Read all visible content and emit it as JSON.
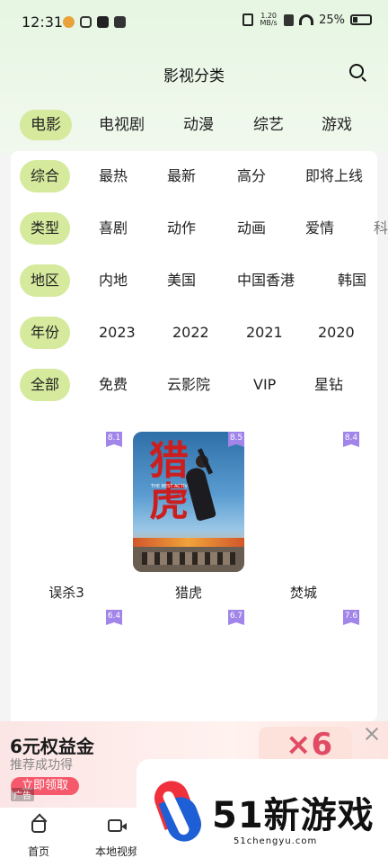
{
  "status_bar": {
    "time": "12:31",
    "net_speed_value": "1.20",
    "net_speed_unit": "MB/s",
    "battery": "25%"
  },
  "header": {
    "title": "影视分类"
  },
  "category_tabs": [
    {
      "label": "电影",
      "active": true
    },
    {
      "label": "电视剧",
      "active": false
    },
    {
      "label": "动漫",
      "active": false
    },
    {
      "label": "综艺",
      "active": false
    },
    {
      "label": "游戏",
      "active": false
    }
  ],
  "filters": [
    {
      "chip": "综合",
      "options": [
        "最热",
        "最新",
        "高分",
        "即将上线"
      ]
    },
    {
      "chip": "类型",
      "options": [
        "喜剧",
        "动作",
        "动画",
        "爱情",
        "科"
      ]
    },
    {
      "chip": "地区",
      "options": [
        "内地",
        "美国",
        "中国香港",
        "韩国"
      ]
    },
    {
      "chip": "年份",
      "options": [
        "2023",
        "2022",
        "2021",
        "2020"
      ]
    },
    {
      "chip": "全部",
      "options": [
        "免费",
        "云影院",
        "VIP",
        "星钻"
      ]
    }
  ],
  "movies": [
    {
      "title": "误杀3",
      "score": "8.1"
    },
    {
      "title": "猎虎",
      "score": "8.5",
      "poster_title": "猎虎",
      "poster_subtitle": "THE BEST ACTIVE"
    },
    {
      "title": "焚城",
      "score": "8.4"
    },
    {
      "title": "",
      "score": "6.4"
    },
    {
      "title": "",
      "score": "6.7"
    },
    {
      "title": "",
      "score": "7.6"
    }
  ],
  "ad": {
    "title": "6元权益金",
    "subtitle": "推荐成功得",
    "cta": "立即领取",
    "tag": "广告",
    "art_text": "×6"
  },
  "bottom_nav": [
    {
      "label": "首页",
      "icon": "home-icon"
    },
    {
      "label": "本地视频",
      "icon": "video-icon"
    }
  ],
  "watermark": {
    "text": "51新游戏",
    "url": "51chengyu.com"
  },
  "colors": {
    "chip_green": "#d5ea9c",
    "score_purple": "#a185e8",
    "cta_red": "#f55a6c"
  }
}
